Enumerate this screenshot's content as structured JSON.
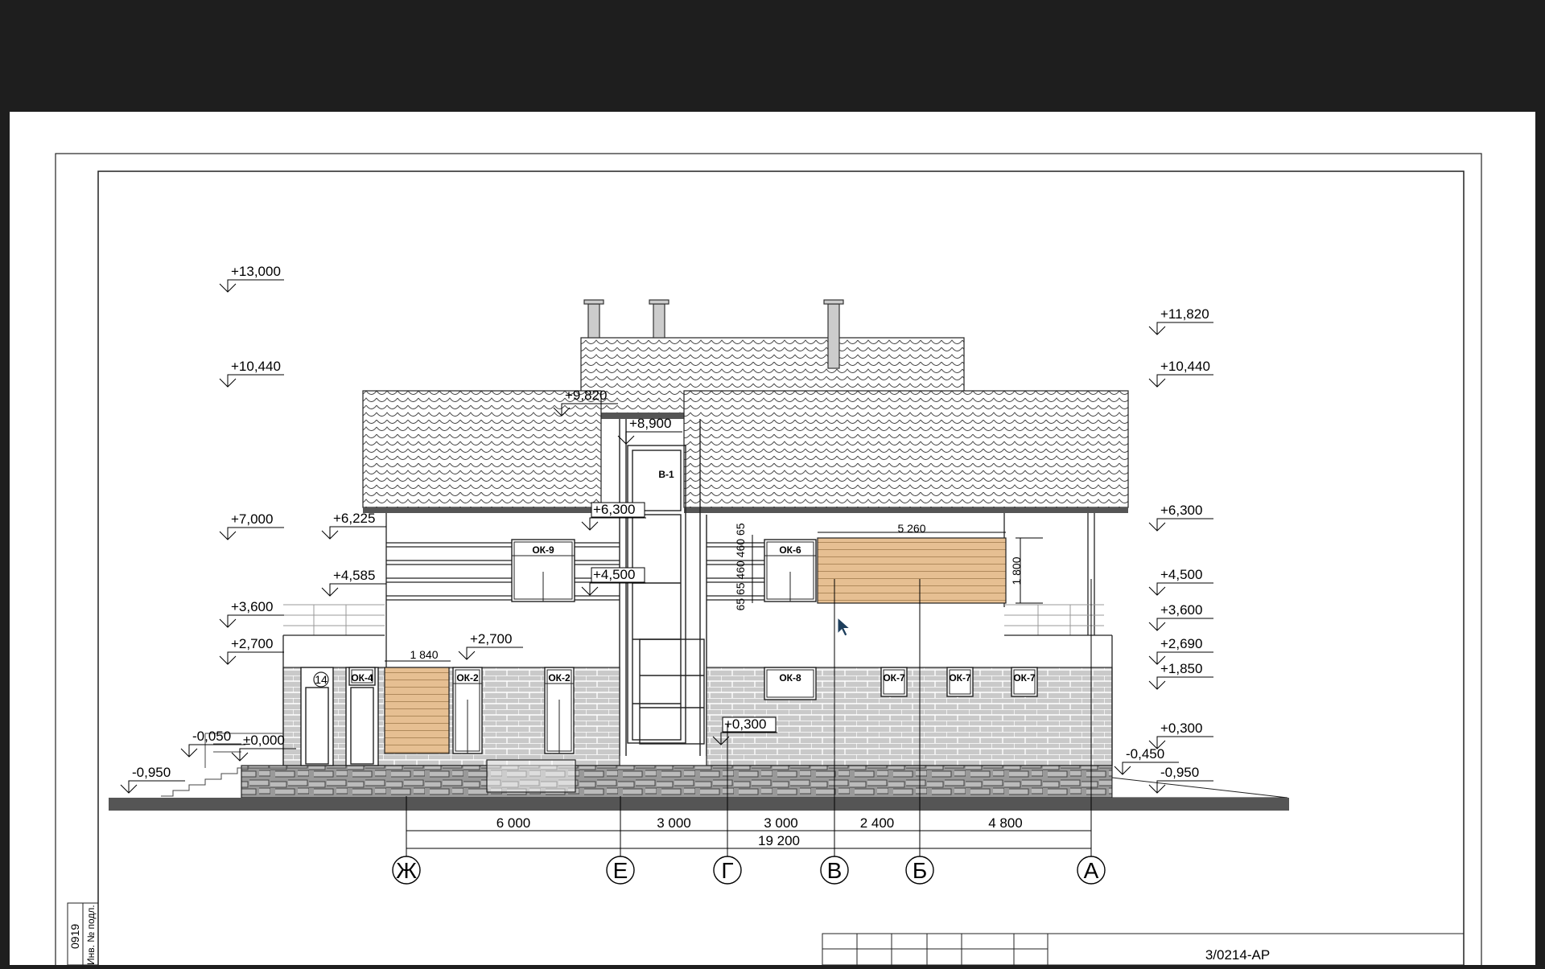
{
  "colors": {
    "background": "#1e1e1e",
    "paper": "#ffffff",
    "wood": "#e6bf92",
    "brick": "#c9c9c9",
    "stone": "#9a9a9a",
    "roof_edge": "#555555"
  },
  "drawing": {
    "left_levels": [
      "+13,000",
      "+10,440",
      "+7,000",
      "+3,600",
      "+2,700",
      "-0,050",
      "-0,950"
    ],
    "right_levels": [
      "+11,820",
      "+10,440",
      "+6,300",
      "+4,500",
      "+3,600",
      "+2,690",
      "+1,850",
      "+0,300",
      "-0,450",
      "-0,950"
    ],
    "inner_levels": [
      "+9,820",
      "+8,900",
      "+6,225",
      "+4,585",
      "+6,300",
      "+4,500",
      "+2,700",
      "+0,300",
      "±0,000"
    ],
    "windows": [
      "ОК-9",
      "ОК-6",
      "ОК-4",
      "ОК-2",
      "ОК-2",
      "ОК-8",
      "ОК-7",
      "ОК-7",
      "ОК-7"
    ],
    "door_label": "В-1",
    "door_number": "14",
    "dims": {
      "top_span": "5 260",
      "height_1800": "1 800",
      "left_span": "1 840",
      "stack": "65 65 460 460 65",
      "segments": [
        "6 000",
        "3 000",
        "3 000",
        "2 400",
        "4 800"
      ],
      "total": "19 200"
    },
    "axes": [
      "Ж",
      "Е",
      "Г",
      "В",
      "Б",
      "А"
    ]
  },
  "stamp": {
    "code": "3/0214-АР",
    "inv_label": "Инв. № подл.",
    "inv_number": "0919"
  }
}
